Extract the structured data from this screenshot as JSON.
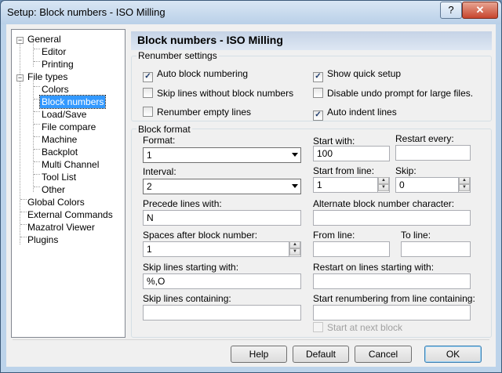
{
  "window": {
    "title": "Setup: Block numbers - ISO Milling",
    "help_glyph": "?",
    "close_glyph": "✕"
  },
  "tree": {
    "items": [
      {
        "label": "General",
        "expander": "−"
      },
      {
        "label": "Editor"
      },
      {
        "label": "Printing"
      },
      {
        "label": "File types",
        "expander": "−"
      },
      {
        "label": "Colors"
      },
      {
        "label": "Block numbers",
        "selected": true
      },
      {
        "label": "Load/Save"
      },
      {
        "label": "File compare"
      },
      {
        "label": "Machine"
      },
      {
        "label": "Backplot"
      },
      {
        "label": "Multi Channel"
      },
      {
        "label": "Tool List"
      },
      {
        "label": "Other"
      },
      {
        "label": "Global Colors"
      },
      {
        "label": "External Commands"
      },
      {
        "label": "Mazatrol Viewer"
      },
      {
        "label": "Plugins"
      }
    ]
  },
  "page_title": "Block numbers - ISO Milling",
  "renumber": {
    "group_label": "Renumber settings",
    "auto_block_numbering": {
      "label": "Auto block numbering",
      "checked": true
    },
    "skip_lines_without": {
      "label": "Skip lines without block numbers",
      "checked": false
    },
    "renumber_empty": {
      "label": "Renumber empty lines",
      "checked": false
    },
    "show_quick_setup": {
      "label": "Show quick setup",
      "checked": true
    },
    "disable_undo_prompt": {
      "label": "Disable undo prompt for large files.",
      "checked": false
    },
    "auto_indent": {
      "label": "Auto indent lines",
      "checked": true
    }
  },
  "block_format": {
    "group_label": "Block format",
    "format_label": "Format:",
    "format_value": "1",
    "interval_label": "Interval:",
    "interval_value": "2",
    "precede_label": "Precede lines with:",
    "precede_value": "N",
    "spaces_label": "Spaces after block number:",
    "spaces_value": "1",
    "skip_starting_label": "Skip lines starting with:",
    "skip_starting_value": "%,O",
    "skip_containing_label": "Skip lines containing:",
    "skip_containing_value": "",
    "start_with_label": "Start with:",
    "start_with_value": "100",
    "restart_every_label": "Restart every:",
    "restart_every_value": "",
    "start_from_line_label": "Start from line:",
    "start_from_line_value": "1",
    "skip_label": "Skip:",
    "skip_value": "0",
    "alt_char_label": "Alternate block number character:",
    "alt_char_value": "",
    "from_line_label": "From line:",
    "from_line_value": "",
    "to_line_label": "To line:",
    "to_line_value": "",
    "restart_on_label": "Restart on lines starting with:",
    "restart_on_value": "",
    "start_renum_label": "Start renumbering from line containing:",
    "start_renum_value": "",
    "start_next_block": {
      "label": "Start at next block",
      "checked": false
    }
  },
  "buttons": {
    "help": "Help",
    "default": "Default",
    "cancel": "Cancel",
    "ok": "OK"
  }
}
